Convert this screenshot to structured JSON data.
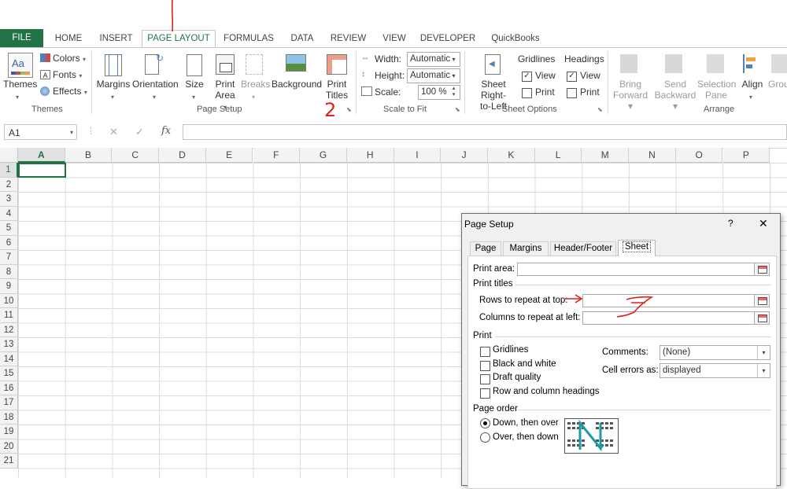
{
  "ribbon": {
    "tabs": [
      "FILE",
      "HOME",
      "INSERT",
      "PAGE LAYOUT",
      "FORMULAS",
      "DATA",
      "REVIEW",
      "VIEW",
      "DEVELOPER",
      "QuickBooks"
    ],
    "themes": {
      "themes": "Themes",
      "colors": "Colors",
      "fonts": "Fonts",
      "effects": "Effects",
      "group": "Themes"
    },
    "page_setup": {
      "margins": "Margins",
      "orientation": "Orientation",
      "size": "Size",
      "print_area_1": "Print",
      "print_area_2": "Area",
      "breaks": "Breaks",
      "background": "Background",
      "print_titles_1": "Print",
      "print_titles_2": "Titles",
      "group": "Page Setup"
    },
    "scale_to_fit": {
      "width_label": "Width:",
      "width_value": "Automatic",
      "height_label": "Height:",
      "height_value": "Automatic",
      "scale_label": "Scale:",
      "scale_value": "100 %",
      "group": "Scale to Fit"
    },
    "sheet_options": {
      "sheet_rtl_1": "Sheet Right-",
      "sheet_rtl_2": "to-Left",
      "gridlines": "Gridlines",
      "headings": "Headings",
      "view": "View",
      "print": "Print",
      "group": "Sheet Options"
    },
    "arrange": {
      "bring_1": "Bring",
      "bring_2": "Forward",
      "send_1": "Send",
      "send_2": "Backward",
      "selection_1": "Selection",
      "selection_2": "Pane",
      "align": "Align",
      "group_btn": "Grou",
      "group": "Arrange"
    }
  },
  "formula_bar": {
    "name_box": "A1",
    "fx": "fx",
    "cancel": "✕",
    "enter": "✓"
  },
  "grid": {
    "columns": [
      "A",
      "B",
      "C",
      "D",
      "E",
      "F",
      "G",
      "H",
      "I",
      "J",
      "K",
      "L",
      "M",
      "N",
      "O",
      "P"
    ],
    "rows": [
      "1",
      "2",
      "3",
      "4",
      "5",
      "6",
      "7",
      "8",
      "9",
      "10",
      "11",
      "12",
      "13",
      "14",
      "15",
      "16",
      "17",
      "18",
      "19",
      "20",
      "21"
    ]
  },
  "dialog": {
    "title": "Page Setup",
    "help": "?",
    "close": "✕",
    "tabs": [
      "Page",
      "Margins",
      "Header/Footer",
      "Sheet"
    ],
    "print_area_label": "Print area:",
    "print_titles_label": "Print titles",
    "rows_repeat_label": "Rows to repeat at top:",
    "cols_repeat_label": "Columns to repeat at left:",
    "print_label": "Print",
    "gridlines": "Gridlines",
    "black_white": "Black and white",
    "draft": "Draft quality",
    "row_col_headings": "Row and column headings",
    "comments_label": "Comments:",
    "comments_value": "(None)",
    "cell_errors_label": "Cell errors as:",
    "cell_errors_value": "displayed",
    "page_order_label": "Page order",
    "down_over": "Down, then over",
    "over_down": "Over, then down"
  },
  "annotations": {
    "number_2": "2"
  },
  "colors": {
    "excel_green": "#217346",
    "annotation_red": "#e0201a"
  }
}
